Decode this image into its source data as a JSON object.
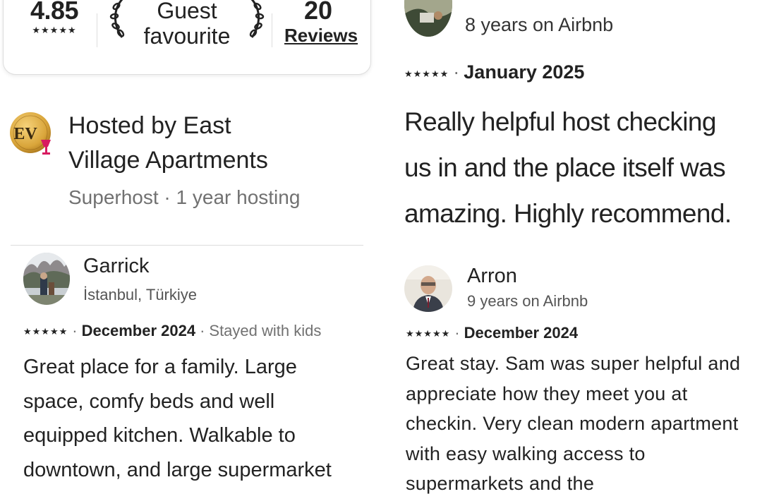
{
  "stats": {
    "rating": "4.85",
    "rating_stars": "★★★★★",
    "guest_favourite": "Guest favourite",
    "reviews_count": "20",
    "reviews_label": "Reviews"
  },
  "host": {
    "logo_text": "EV",
    "title": "Hosted by East Village Apartments",
    "subtitle": "Superhost · 1 year hosting"
  },
  "reviews": [
    {
      "name": "",
      "meta": "8 years on Airbnb",
      "stars": "★★★★★",
      "date": "January 2025",
      "extra": "",
      "text": "Really helpful host checking us in and the place itself was amazing. Highly recommend."
    },
    {
      "name": "Garrick",
      "meta": "İstanbul, Türkiye",
      "stars": "★★★★★",
      "date": "December 2024",
      "extra": "Stayed with kids",
      "text": "Great place for a family. Large space, comfy beds and well equipped kitchen. Walkable to downtown, and large supermarket"
    },
    {
      "name": "Arron",
      "meta": "9 years on Airbnb",
      "stars": "★★★★★",
      "date": "December 2024",
      "extra": "",
      "text": "Great stay. Sam was super helpful and appreciate how they meet you at checkin. Very clean modern apartment with easy walking access to supermarkets and the"
    }
  ],
  "colors": {
    "text": "#222222",
    "muted": "#717171",
    "divider": "#dddddd",
    "logo_gold": "#d9a53a",
    "logo_pink": "#d81b60"
  },
  "icons": [
    "star-icon",
    "laurel-left-icon",
    "laurel-right-icon",
    "host-logo-icon",
    "avatar-photo"
  ]
}
